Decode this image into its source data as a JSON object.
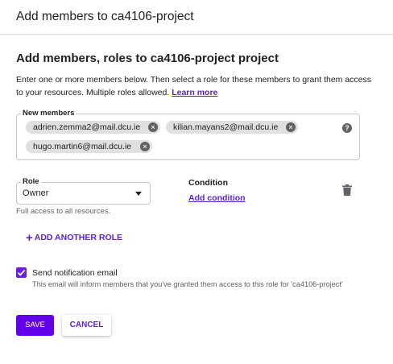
{
  "dialog": {
    "title": "Add members to ca4106-project"
  },
  "section": {
    "title": "Add members, roles to ca4106-project project",
    "description": "Enter one or more members below. Then select a role for these members to grant them access to your resources. Multiple roles allowed.",
    "learn_more": "Learn more"
  },
  "members": {
    "label": "New members",
    "chips": [
      "adrien.zemma2@mail.dcu.ie",
      "kilian.mayans2@mail.dcu.ie",
      "hugo.martin6@mail.dcu.ie"
    ],
    "help_icon": "?"
  },
  "role": {
    "label": "Role",
    "value": "Owner",
    "hint": "Full access to all resources."
  },
  "condition": {
    "title": "Condition",
    "add_link": "Add condition"
  },
  "add_role": {
    "label": "ADD ANOTHER ROLE"
  },
  "notification": {
    "checked": true,
    "label": "Send notification email",
    "hint": "This email will inform members that you've granted them access to this role for 'ca4106-project'"
  },
  "actions": {
    "save": "SAVE",
    "cancel": "CANCEL"
  },
  "colors": {
    "accent": "#6200ea",
    "link": "#5b1fd6",
    "chip_bg": "#e0e0e0"
  }
}
